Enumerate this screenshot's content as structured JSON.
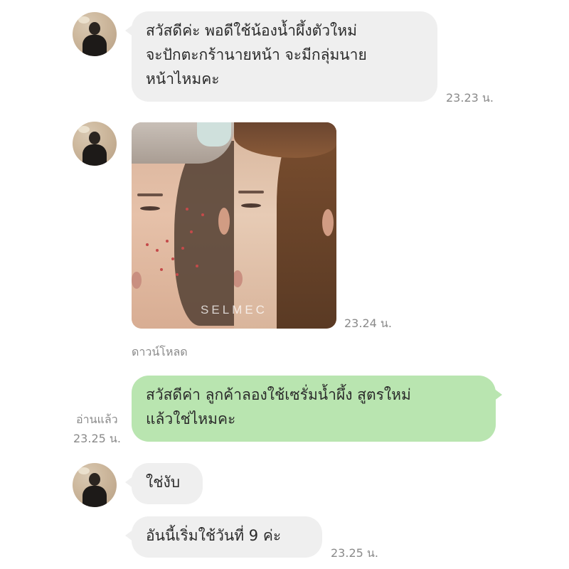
{
  "messages": {
    "m1": {
      "text_line1": "สวัสดีค่ะ พอดีใช้น้องน้ำผึ้งตัวใหม่",
      "text_line2": "จะปักตะกร้านายหน้า จะมีกลุ่มนาย",
      "text_line3": "หน้าไหมคะ",
      "time": "23.23 น."
    },
    "m2": {
      "image_watermark": "SELMEC",
      "time": "23.24 น.",
      "download_label": "ดาวน์โหลด"
    },
    "m3": {
      "text_line1": "สวัสดีค่า ลูกค้าลองใช้เซรั่มน้ำผึ้ง สูตรใหม่",
      "text_line2": "แล้วใช่ไหมคะ",
      "read_label": "อ่านแล้ว",
      "time": "23.25 น."
    },
    "m4": {
      "text": "ใช่งับ"
    },
    "m5": {
      "text": "อันนี้เริ่มใช้วันที่ 9 ค่ะ",
      "time": "23.25 น."
    }
  },
  "colors": {
    "incoming_bubble": "#efefef",
    "outgoing_bubble": "#b9e5b0",
    "timestamp": "#8a8a8a"
  }
}
